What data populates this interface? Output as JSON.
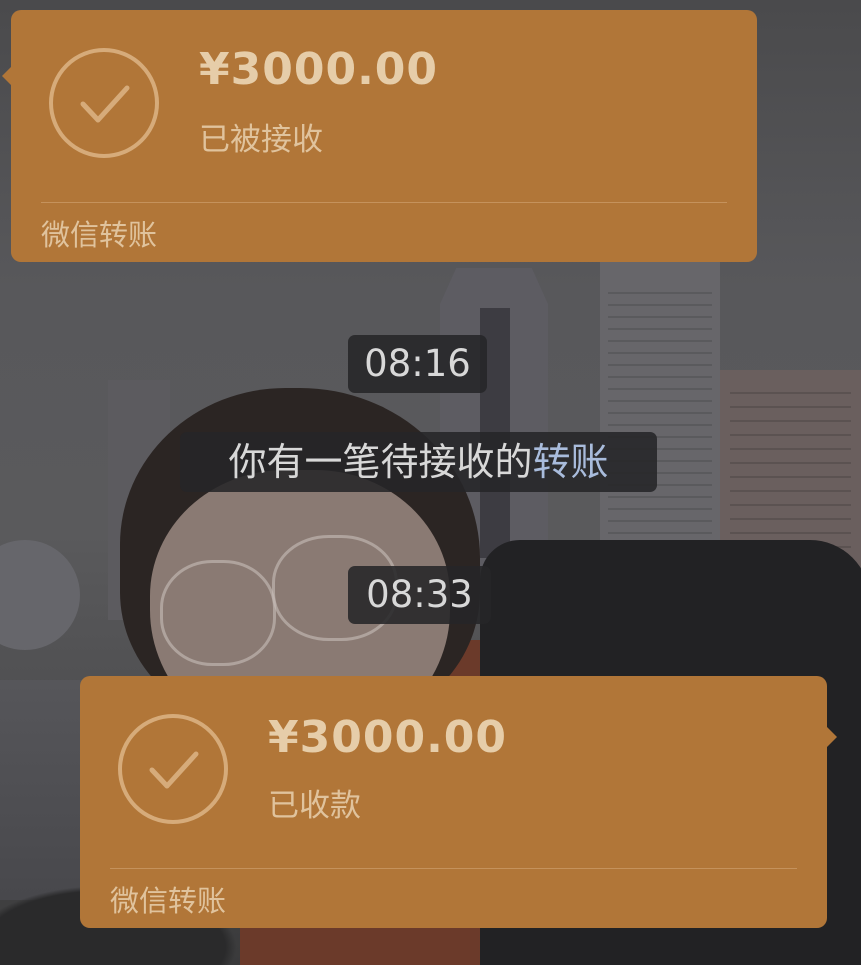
{
  "messages": [
    {
      "type": "transfer",
      "amount": "¥3000.00",
      "status": "已被接收",
      "footer": "微信转账"
    },
    {
      "type": "time",
      "text": "08:16"
    },
    {
      "type": "system",
      "text": "你有一笔待接收的",
      "link": "转账"
    },
    {
      "type": "time",
      "text": "08:33"
    },
    {
      "type": "transfer",
      "amount": "¥3000.00",
      "status": "已收款",
      "footer": "微信转账"
    }
  ],
  "colors": {
    "bubble": "#b17638",
    "bubble_text": "#e3c9a4",
    "system_bg": "#262628",
    "link": "#a9bcdc"
  },
  "icons": {
    "transfer_status": "check-circle-icon"
  }
}
